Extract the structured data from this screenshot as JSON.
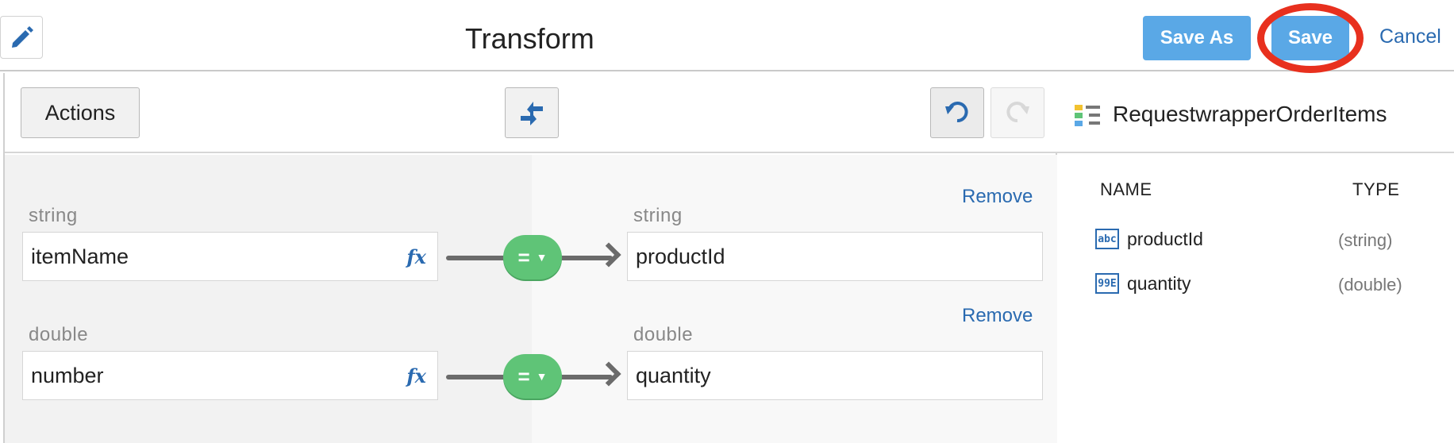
{
  "header": {
    "title": "Transform",
    "save_as_label": "Save As",
    "save_label": "Save",
    "cancel_label": "Cancel",
    "highlight_color": "#e8301e",
    "accent_color": "#5aa8e6",
    "link_color": "#2a6ab0"
  },
  "toolbar": {
    "actions_label": "Actions",
    "auto_map_icon": "auto-map-icon",
    "undo_icon": "undo-icon",
    "redo_icon": "redo-icon"
  },
  "mappings": [
    {
      "source_type": "string",
      "source_field": "itemName",
      "function_icon": "fx",
      "operator": "=",
      "target_type": "string",
      "target_field": "productId",
      "remove_label": "Remove"
    },
    {
      "source_type": "double",
      "source_field": "number",
      "function_icon": "fx",
      "operator": "=",
      "target_type": "double",
      "target_field": "quantity",
      "remove_label": "Remove"
    }
  ],
  "schema": {
    "title": "RequestwrapperOrderItems",
    "columns": {
      "name": "NAME",
      "type": "TYPE"
    },
    "fields": [
      {
        "icon": "abc",
        "name": "productId",
        "type": "(string)"
      },
      {
        "icon": "99E",
        "name": "quantity",
        "type": "(double)"
      }
    ]
  }
}
